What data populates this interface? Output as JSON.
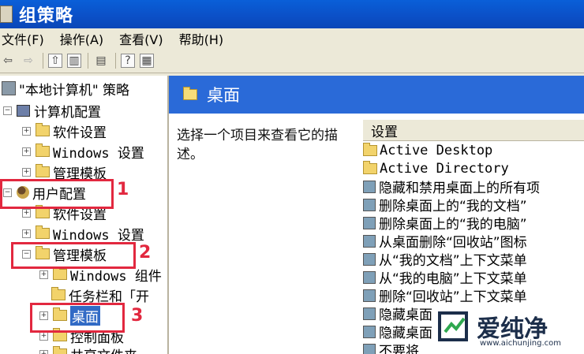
{
  "window": {
    "title": "组策略"
  },
  "menu": [
    "文件(F)",
    "操作(A)",
    "查看(V)",
    "帮助(H)"
  ],
  "tree": {
    "root": "\"本地计算机\" 策略",
    "computer_config": "计算机配置",
    "c_software": "软件设置",
    "c_windows": "Windows 设置",
    "c_admin": "管理模板",
    "user_config": "用户配置",
    "u_software": "软件设置",
    "u_windows": "Windows 设置",
    "u_admin": "管理模板",
    "u_admin_windows": "Windows 组件",
    "u_admin_taskbar": "任务栏和「开",
    "u_admin_desktop": "桌面",
    "u_admin_control": "控制面板",
    "u_admin_shared": "共享文件夹"
  },
  "annotations": [
    "1",
    "2",
    "3"
  ],
  "right_pane": {
    "header": "桌面",
    "description": "选择一个项目来查看它的描述。",
    "column_header": "设置",
    "items": [
      "Active Desktop",
      "Active Directory",
      "隐藏和禁用桌面上的所有项",
      "删除桌面上的“我的文档”",
      "删除桌面上的“我的电脑”",
      "从桌面删除“回收站”图标",
      "从“我的文档”上下文菜单",
      "从“我的电脑”上下文菜单",
      "删除“回收站”上下文菜单",
      "隐藏桌面",
      "隐藏桌面",
      "不要将"
    ]
  },
  "watermark": {
    "text": "爱纯净",
    "url": "www.aichunjing.com"
  }
}
